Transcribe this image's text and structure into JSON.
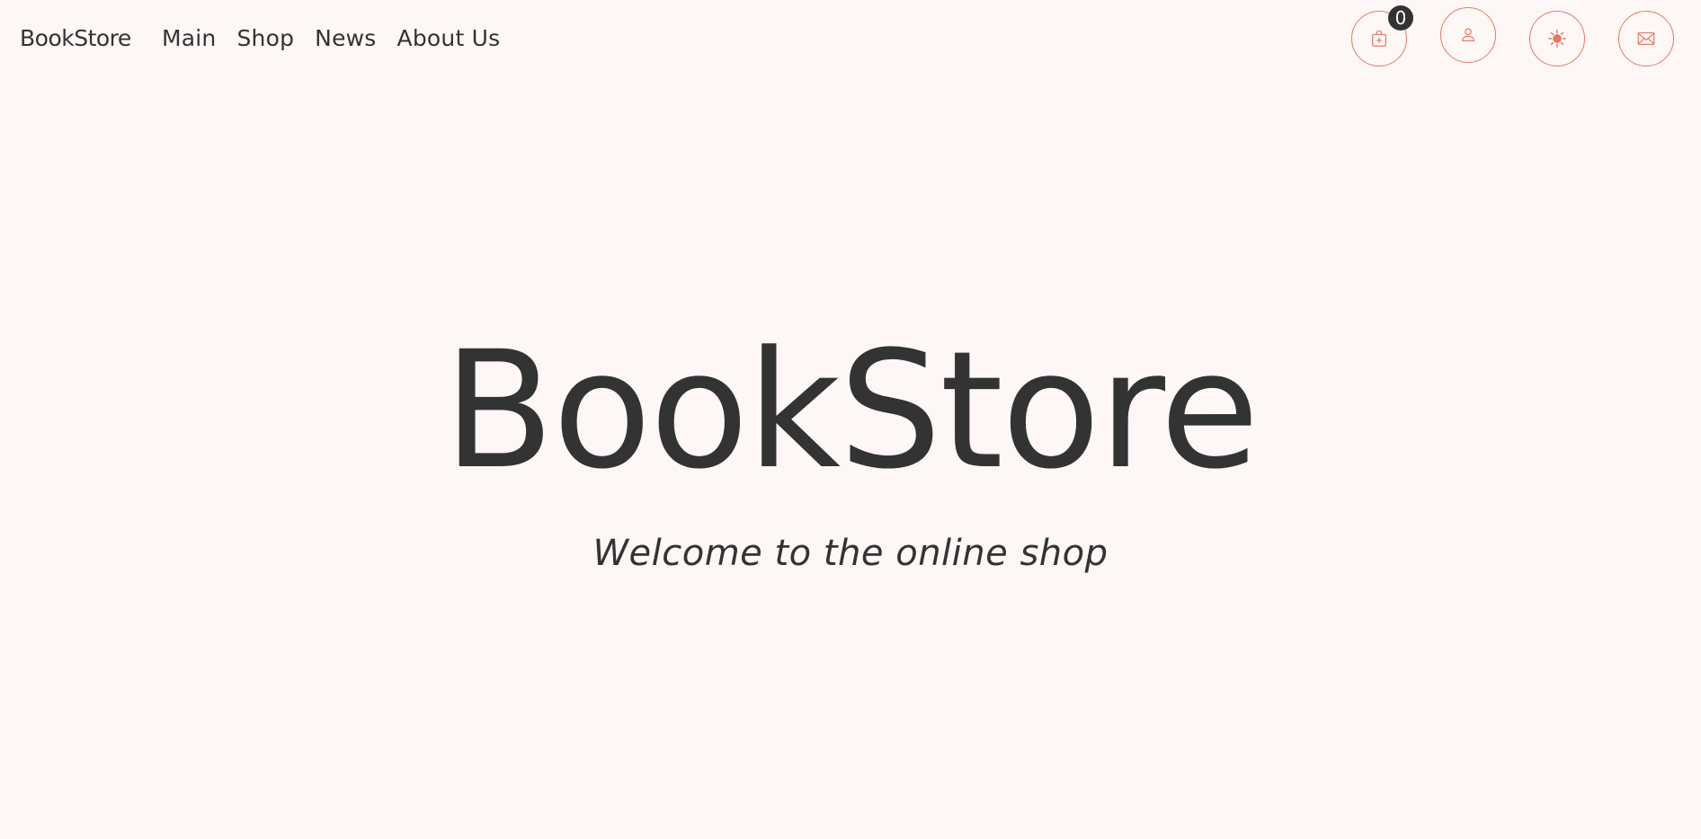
{
  "header": {
    "brand": "BookStore",
    "nav": [
      {
        "label": "Main"
      },
      {
        "label": "Shop"
      },
      {
        "label": "News"
      },
      {
        "label": "About Us"
      }
    ],
    "icons": {
      "cart": "cart-icon",
      "profile": "user-icon",
      "theme": "sun-icon",
      "mail": "mail-icon"
    },
    "cart_count": "0"
  },
  "hero": {
    "title": "BookStore",
    "subtitle": "Welcome to the online shop"
  },
  "colors": {
    "background": "#fdf7f6",
    "text": "#333333",
    "accent": "#e07a66",
    "badge": "#333333"
  }
}
